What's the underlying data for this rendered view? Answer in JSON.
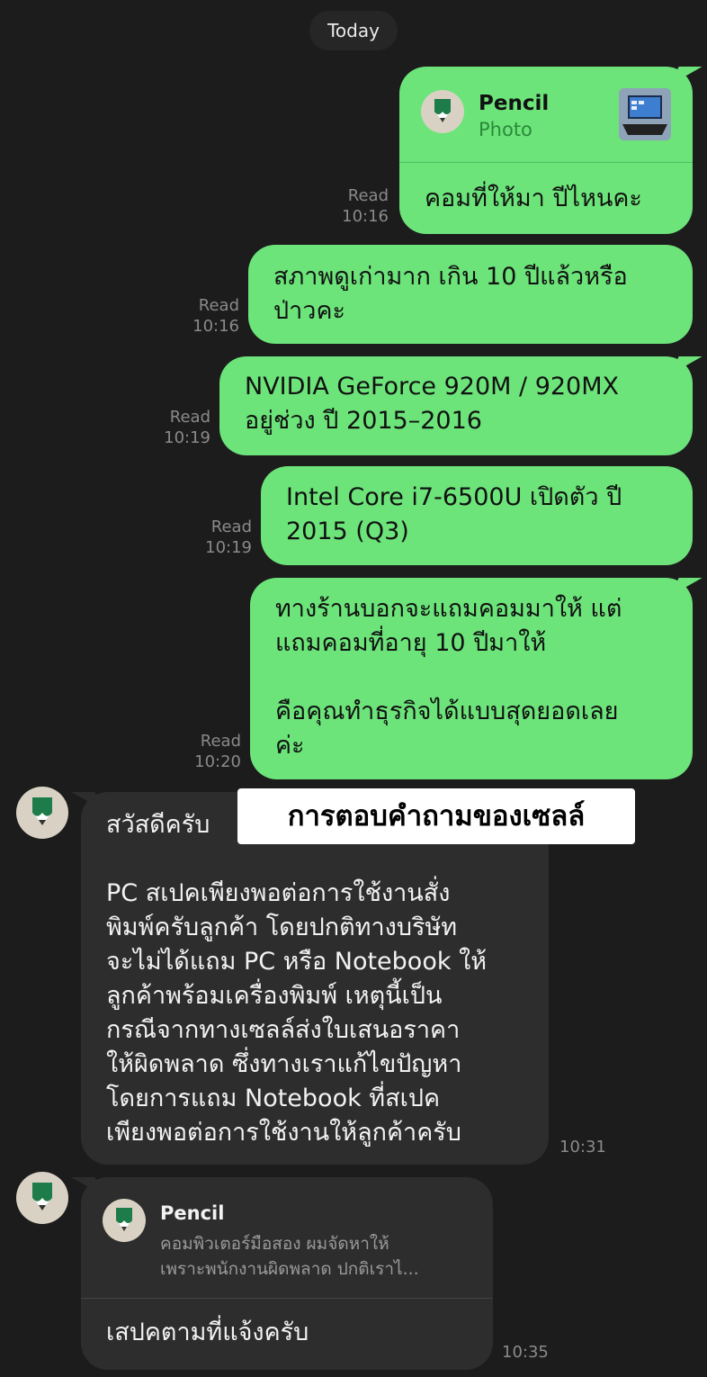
{
  "date_label": "Today",
  "messages_out": [
    {
      "quote": {
        "name": "Pencil",
        "type": "Photo"
      },
      "text": "คอมที่ให้มา ปีไหนคะ",
      "status": "Read",
      "time": "10:16"
    },
    {
      "text": "สภาพดูเก่ามาก เกิน 10 ปีแล้วหรือ\nป่าวคะ",
      "status": "Read",
      "time": "10:16"
    },
    {
      "text": "NVIDIA GeForce 920M / 920MX\nอยู่ช่วง ปี 2015–2016",
      "status": "Read",
      "time": "10:19"
    },
    {
      "text": "Intel Core i7-6500U เปิดตัว ปี\n2015 (Q3)",
      "status": "Read",
      "time": "10:19"
    },
    {
      "text": "ทางร้านบอกจะแถมคอมมาให้ แต่\nแถมคอมที่อายุ 10 ปีมาให้\n\nคือคุณทำธุรกิจได้แบบสุดยอดเลย\nค่ะ",
      "status": "Read",
      "time": "10:20"
    }
  ],
  "messages_in": [
    {
      "text": "สวัสดีครับ\n\nPC สเปคเพียงพอต่อการใช้งานสั่ง\nพิมพ์ครับลูกค้า โดยปกติทางบริษัท\nจะไม่ได้แถม PC หรือ Notebook ให้\nลูกค้าพร้อมเครื่องพิมพ์ เหตุนี้เป็น\nกรณีจากทางเซลล์ส่งใบเสนอราคา\nให้ผิดพลาด ซึ่งทางเราแก้ไขปัญหา\nโดยการแถม Notebook ที่สเปค\nเพียงพอต่อการใช้งานให้ลูกค้าครับ",
      "time": "10:31"
    },
    {
      "quote": {
        "name": "Pencil",
        "text": "คอมพิวเตอร์มือสอง ผมจัดหาให้\nเพราะพนักงานผิดพลาด ปกติเราไ..."
      },
      "text": "เสปคตามที่แจ้งครับ",
      "time": "10:35"
    }
  ],
  "overlay_label": "การตอบคำถามของเซลล์",
  "colors": {
    "background": "#1c1c1c",
    "outgoing_bubble": "#6ce47a",
    "incoming_bubble": "#2d2d2d",
    "meta_text": "#8a8a8a",
    "avatar_bg": "#d9d2c4",
    "pencil_green": "#1e7b4a"
  },
  "icons": {
    "avatar": "pencil-logo-icon",
    "photo": "photo-thumbnail-icon"
  }
}
